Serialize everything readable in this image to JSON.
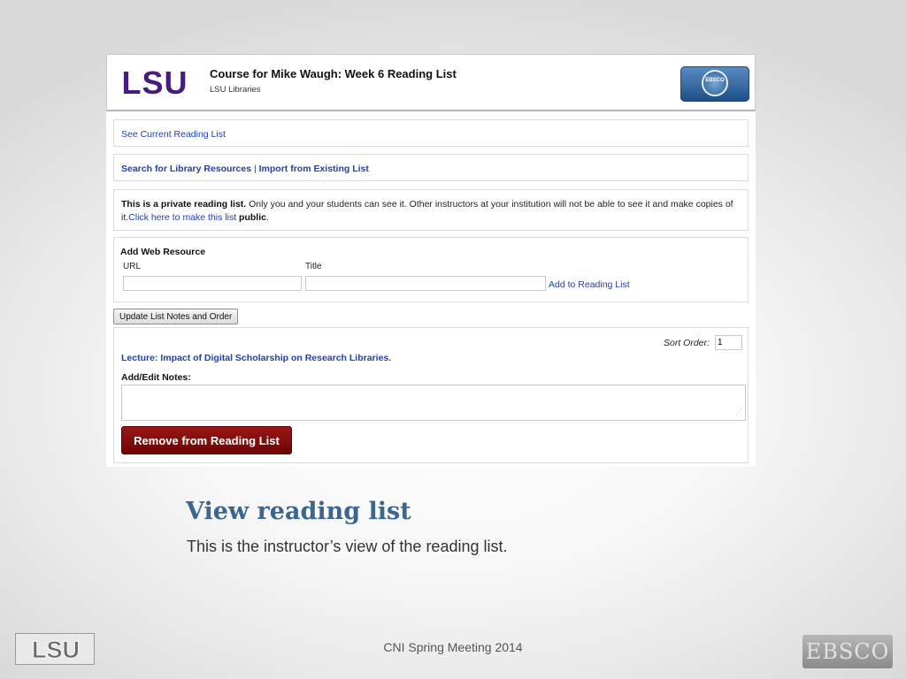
{
  "header": {
    "logo_text": "LSU",
    "course_title": "Course for Mike Waugh: Week 6 Reading List",
    "course_subtitle": "LSU Libraries",
    "badge_text": "EBSCO"
  },
  "links": {
    "see_current": "See Current Reading List",
    "search_resources": "Search for Library Resources",
    "separator": " | ",
    "import_existing": "Import from Existing List"
  },
  "private_notice": {
    "bold": "This is a private reading list.",
    "body": " Only you and your students can see it. Other instructors at your institution will not be able to see it and make copies of it.",
    "link_text": "Click here to make this list ",
    "link_bold": "public",
    "end": "."
  },
  "web_resource": {
    "heading": "Add Web Resource",
    "url_label": "URL",
    "title_label": "Title",
    "url_value": "",
    "title_value": "",
    "add_link": "Add to Reading List"
  },
  "update_button": "Update List Notes and Order",
  "item": {
    "sort_label": "Sort Order:",
    "sort_value": "1",
    "lecture_title": "Lecture: Impact of Digital Scholarship on Research Libraries.",
    "notes_label": "Add/Edit Notes:",
    "notes_value": "",
    "remove_button": "Remove from Reading List"
  },
  "slide": {
    "title": "View reading list",
    "description": "This is the instructor’s view of the reading list.",
    "footer": "CNI Spring Meeting 2014",
    "footer_logo_left": "LSU",
    "footer_logo_right": "EBSCO"
  },
  "colors": {
    "lsu_purple": "#461D7C",
    "link_blue": "#1f3fb5",
    "remove_red": "#8b0e0e",
    "title_blue": "#3a6690"
  }
}
